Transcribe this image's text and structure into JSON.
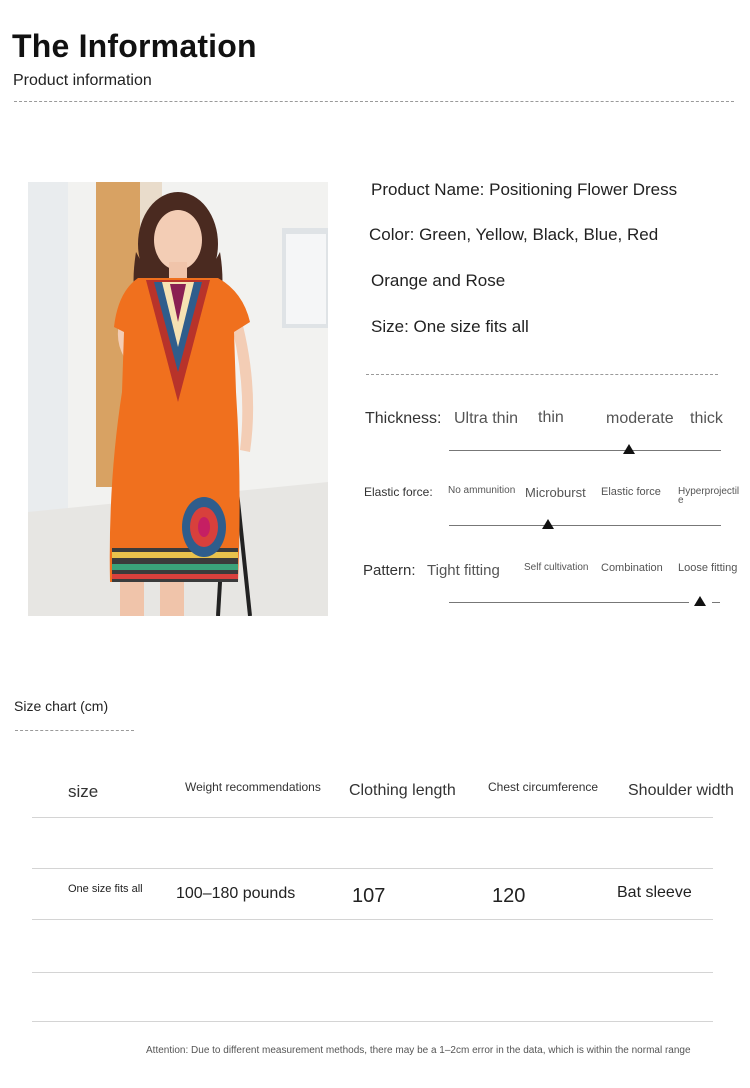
{
  "header": {
    "title": "The Information",
    "subtitle": "Product information"
  },
  "product": {
    "name": "Product Name: Positioning Flower Dress",
    "color": "Color: Green, Yellow, Black, Blue, Red",
    "color_cont": "Orange and Rose",
    "size": "Size: One size fits all"
  },
  "scales": {
    "thickness": {
      "label": "Thickness:",
      "options": [
        "Ultra thin",
        "thin",
        "moderate",
        "thick"
      ],
      "selected": "moderate"
    },
    "elastic": {
      "label": "Elastic force:",
      "options": [
        "No ammunition",
        "Microburst",
        "Elastic force",
        "Hyperprojectile"
      ],
      "selected": "Microburst"
    },
    "pattern": {
      "label": "Pattern:",
      "options": [
        "Tight fitting",
        "Self cultivation",
        "Combination",
        "Loose fitting"
      ],
      "selected": "Loose fitting"
    }
  },
  "size_chart": {
    "title": "Size chart (cm)",
    "headers": [
      "size",
      "Weight recommendations",
      "Clothing length",
      "Chest circumference",
      "Shoulder width"
    ],
    "row": [
      "One size fits all",
      "100–180 pounds",
      "107",
      "120",
      "Bat sleeve"
    ]
  },
  "note": "Attention: Due to different measurement methods, there may be a 1–2cm error in the data, which is within the normal range",
  "colors": {
    "dress": "#f0701e",
    "accent_dark": "#111111"
  }
}
